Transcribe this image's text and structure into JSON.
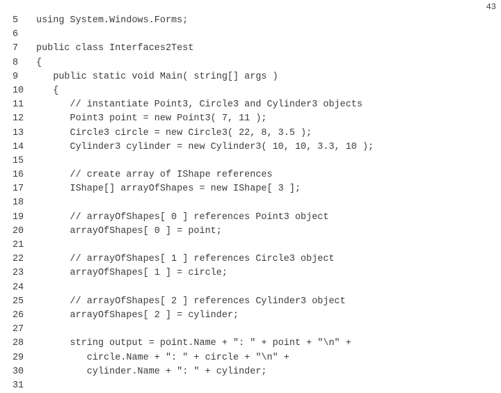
{
  "slide": {
    "page_number": "43",
    "background_color": "#ffffff",
    "text_color": "#3b3b3b",
    "language": "csharp",
    "listing_title": "Interfaces2Test"
  },
  "code": {
    "first_line_number": 5,
    "last_line_number": 31,
    "lines": [
      {
        "number": "5",
        "text": "using System.Windows.Forms;"
      },
      {
        "number": "6",
        "text": ""
      },
      {
        "number": "7",
        "text": "public class Interfaces2Test"
      },
      {
        "number": "8",
        "text": "{"
      },
      {
        "number": "9",
        "text": "   public static void Main( string[] args )"
      },
      {
        "number": "10",
        "text": "   {"
      },
      {
        "number": "11",
        "text": "      // instantiate Point3, Circle3 and Cylinder3 objects"
      },
      {
        "number": "12",
        "text": "      Point3 point = new Point3( 7, 11 );"
      },
      {
        "number": "13",
        "text": "      Circle3 circle = new Circle3( 22, 8, 3.5 );"
      },
      {
        "number": "14",
        "text": "      Cylinder3 cylinder = new Cylinder3( 10, 10, 3.3, 10 );"
      },
      {
        "number": "15",
        "text": ""
      },
      {
        "number": "16",
        "text": "      // create array of IShape references"
      },
      {
        "number": "17",
        "text": "      IShape[] arrayOfShapes = new IShape[ 3 ];"
      },
      {
        "number": "18",
        "text": ""
      },
      {
        "number": "19",
        "text": "      // arrayOfShapes[ 0 ] references Point3 object"
      },
      {
        "number": "20",
        "text": "      arrayOfShapes[ 0 ] = point;"
      },
      {
        "number": "21",
        "text": ""
      },
      {
        "number": "22",
        "text": "      // arrayOfShapes[ 1 ] references Circle3 object"
      },
      {
        "number": "23",
        "text": "      arrayOfShapes[ 1 ] = circle;"
      },
      {
        "number": "24",
        "text": ""
      },
      {
        "number": "25",
        "text": "      // arrayOfShapes[ 2 ] references Cylinder3 object"
      },
      {
        "number": "26",
        "text": "      arrayOfShapes[ 2 ] = cylinder;"
      },
      {
        "number": "27",
        "text": ""
      },
      {
        "number": "28",
        "text": "      string output = point.Name + \": \" + point + \"\\n\" +"
      },
      {
        "number": "29",
        "text": "         circle.Name + \": \" + circle + \"\\n\" +"
      },
      {
        "number": "30",
        "text": "         cylinder.Name + \": \" + cylinder;"
      },
      {
        "number": "31",
        "text": ""
      }
    ]
  }
}
